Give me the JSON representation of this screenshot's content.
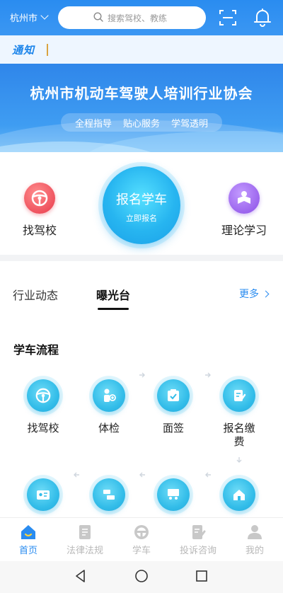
{
  "header": {
    "city": "杭州市",
    "search_placeholder": "搜索驾校、教练"
  },
  "notice": {
    "tag": "通知"
  },
  "banner": {
    "title": "杭州市机动车驾驶人培训行业协会",
    "slogans": [
      "全程指导",
      "贴心服务",
      "学驾透明"
    ]
  },
  "quick": {
    "left_label": "找驾校",
    "center_title": "报名学车",
    "center_sub": "立即报名",
    "right_label": "理论学习"
  },
  "tabs": {
    "items": [
      "行业动态",
      "曝光台"
    ],
    "more": "更多"
  },
  "process": {
    "title": "学车流程",
    "steps": [
      "找驾校",
      "体检",
      "面签",
      "报名缴\n费"
    ]
  },
  "tabbar": {
    "items": [
      "首页",
      "法律法规",
      "学车",
      "投诉咨询",
      "我的"
    ],
    "active_color": "#2a8cf0",
    "inactive_color": "#b8b8b8"
  },
  "colors": {
    "brand_blue": "#2a8cf0",
    "process_icon": "#33bde9"
  }
}
